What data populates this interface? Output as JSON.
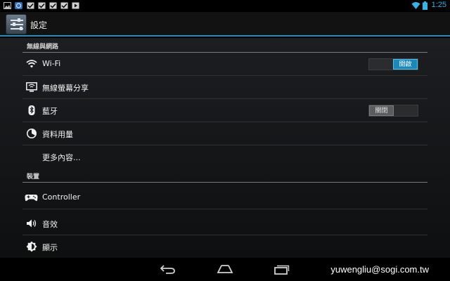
{
  "status_bar": {
    "time": "1:25",
    "notification_icons": [
      "image-icon",
      "browser-icon",
      "check-icon",
      "check-icon",
      "check-icon",
      "check-icon",
      "play-icon"
    ],
    "accent_color": "#33b5e5"
  },
  "action_bar": {
    "title": "設定",
    "icon": "settings-sliders-icon"
  },
  "sections": {
    "wireless": {
      "header": "無線與網路",
      "wifi": {
        "label": "Wi-Fi",
        "icon": "wifi-icon",
        "switch": "開啟"
      },
      "wireless_display": {
        "label": "無線螢幕分享",
        "icon": "screen-share-icon"
      },
      "bluetooth": {
        "label": "藍牙",
        "icon": "bluetooth-icon",
        "switch": "關閉"
      },
      "data_usage": {
        "label": "資料用量",
        "icon": "data-usage-icon"
      },
      "more": {
        "label": "更多內容..."
      }
    },
    "device": {
      "header": "裝置",
      "controller": {
        "label": "Controller",
        "icon": "gamepad-icon"
      },
      "sound": {
        "label": "音效",
        "icon": "speaker-icon"
      },
      "display": {
        "label": "顯示",
        "icon": "brightness-icon"
      }
    }
  },
  "nav_bar": {
    "buttons": [
      "back-icon",
      "home-icon",
      "recent-apps-icon"
    ],
    "watermark": "yuwengliu@sogi.com.tw"
  },
  "colors": {
    "switch_on": "#1a88b8",
    "divider_accent": "#1f8fbd"
  }
}
